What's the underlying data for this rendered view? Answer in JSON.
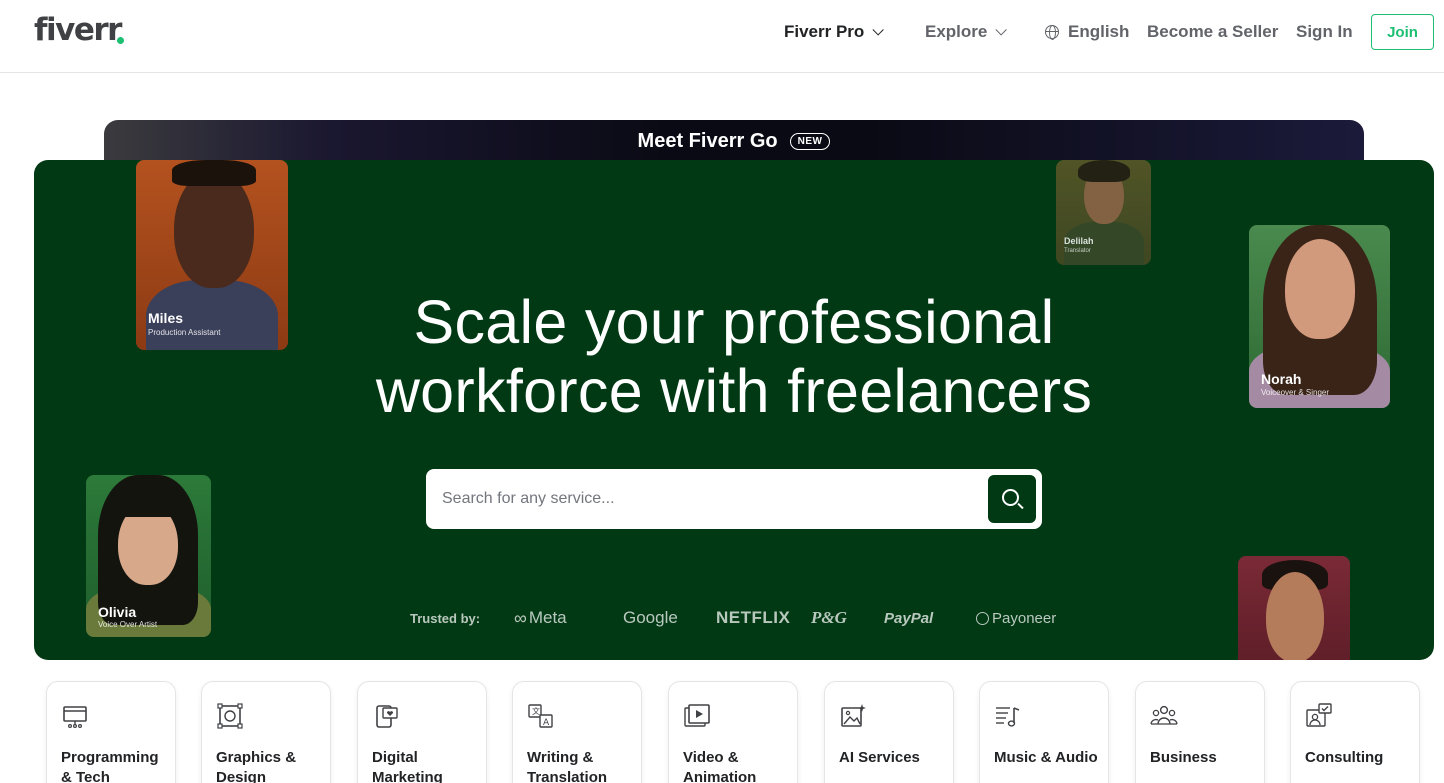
{
  "header": {
    "logo": "fiverr",
    "nav": {
      "fiverr_pro": "Fiverr Pro",
      "explore": "Explore",
      "language": "English",
      "become_seller": "Become a Seller",
      "sign_in": "Sign In",
      "join": "Join"
    },
    "brand_color": "#1dbf73"
  },
  "banner": {
    "text": "Meet Fiverr Go",
    "badge": "NEW"
  },
  "hero": {
    "background": "#013914",
    "title_line1": "Scale your professional",
    "title_line2": "workforce with freelancers",
    "search": {
      "placeholder": "Search for any service...",
      "icon": "search-icon"
    },
    "trusted_label": "Trusted by:",
    "brands": [
      "Meta",
      "Google",
      "NETFLIX",
      "P&G",
      "PayPal",
      "Payoneer"
    ],
    "people": [
      {
        "name": "Miles",
        "role": "Production Assistant"
      },
      {
        "name": "Delilah",
        "role": "Translator"
      },
      {
        "name": "Norah",
        "role": "Voiceover & Singer"
      },
      {
        "name": "Olivia",
        "role": "Voice Over Artist"
      },
      {
        "name": "",
        "role": ""
      }
    ]
  },
  "categories": [
    {
      "label": "Programming & Tech",
      "icon": "monitor-icon"
    },
    {
      "label": "Graphics & Design",
      "icon": "design-frame-icon"
    },
    {
      "label": "Digital Marketing",
      "icon": "phone-heart-icon"
    },
    {
      "label": "Writing & Translation",
      "icon": "translate-icon"
    },
    {
      "label": "Video & Animation",
      "icon": "video-play-icon"
    },
    {
      "label": "AI Services",
      "icon": "ai-image-icon"
    },
    {
      "label": "Music & Audio",
      "icon": "music-note-icon"
    },
    {
      "label": "Business",
      "icon": "people-group-icon"
    },
    {
      "label": "Consulting",
      "icon": "consulting-icon"
    }
  ]
}
